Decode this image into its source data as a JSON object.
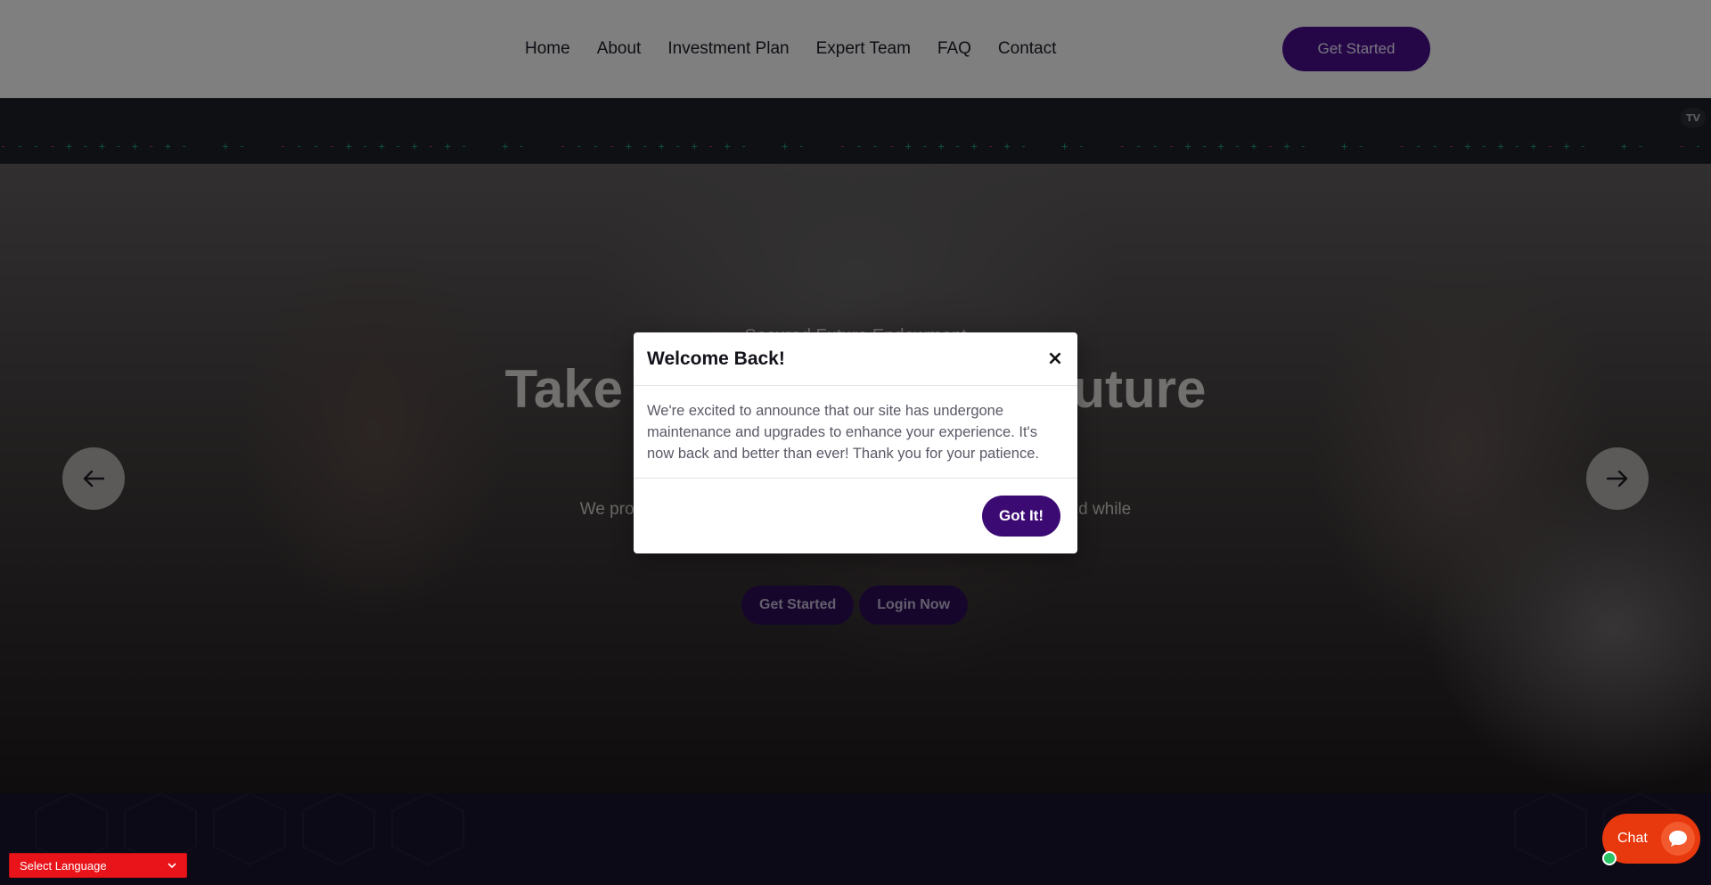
{
  "nav": {
    "items": [
      {
        "label": "Home"
      },
      {
        "label": "About"
      },
      {
        "label": "Investment Plan"
      },
      {
        "label": "Expert Team"
      },
      {
        "label": "FAQ"
      },
      {
        "label": "Contact"
      }
    ],
    "cta_label": "Get Started"
  },
  "ticker": {
    "logo_text": "TV",
    "pattern": "- - - - + - + - + - + -    + -    - - - - + - + - + - + -    + -    - - - - + - + - + - + -    + -    - - - - + - + - + - + -    + -    - - - - + - + - + - + -    + -    - - - - + - + - + - + -    + -    - - - - + - + - + - + -    + -    - - - - + - + - + - + -    + -"
  },
  "hero": {
    "subtitle": "Secured Future Endowment",
    "title": "Take Control of Your Future",
    "description": "We provide an investment strategy that protects our customers fund while",
    "buttons": [
      {
        "label": "Get Started"
      },
      {
        "label": "Login Now"
      }
    ]
  },
  "modal": {
    "title": "Welcome Back!",
    "close_glyph": "×",
    "body": "We're excited to announce that our site has undergone maintenance and upgrades to enhance your experience. It's now back and better than ever! Thank you for your patience.",
    "confirm_label": "Got It!"
  },
  "language": {
    "selected": "Select Language"
  },
  "chat": {
    "label": "Chat"
  },
  "colors": {
    "brand_purple": "#4a0e91",
    "ticker_green": "#1f9e72",
    "ticker_red": "#c2354a",
    "chat_orange": "#e8380e",
    "language_red": "#e8141a"
  }
}
